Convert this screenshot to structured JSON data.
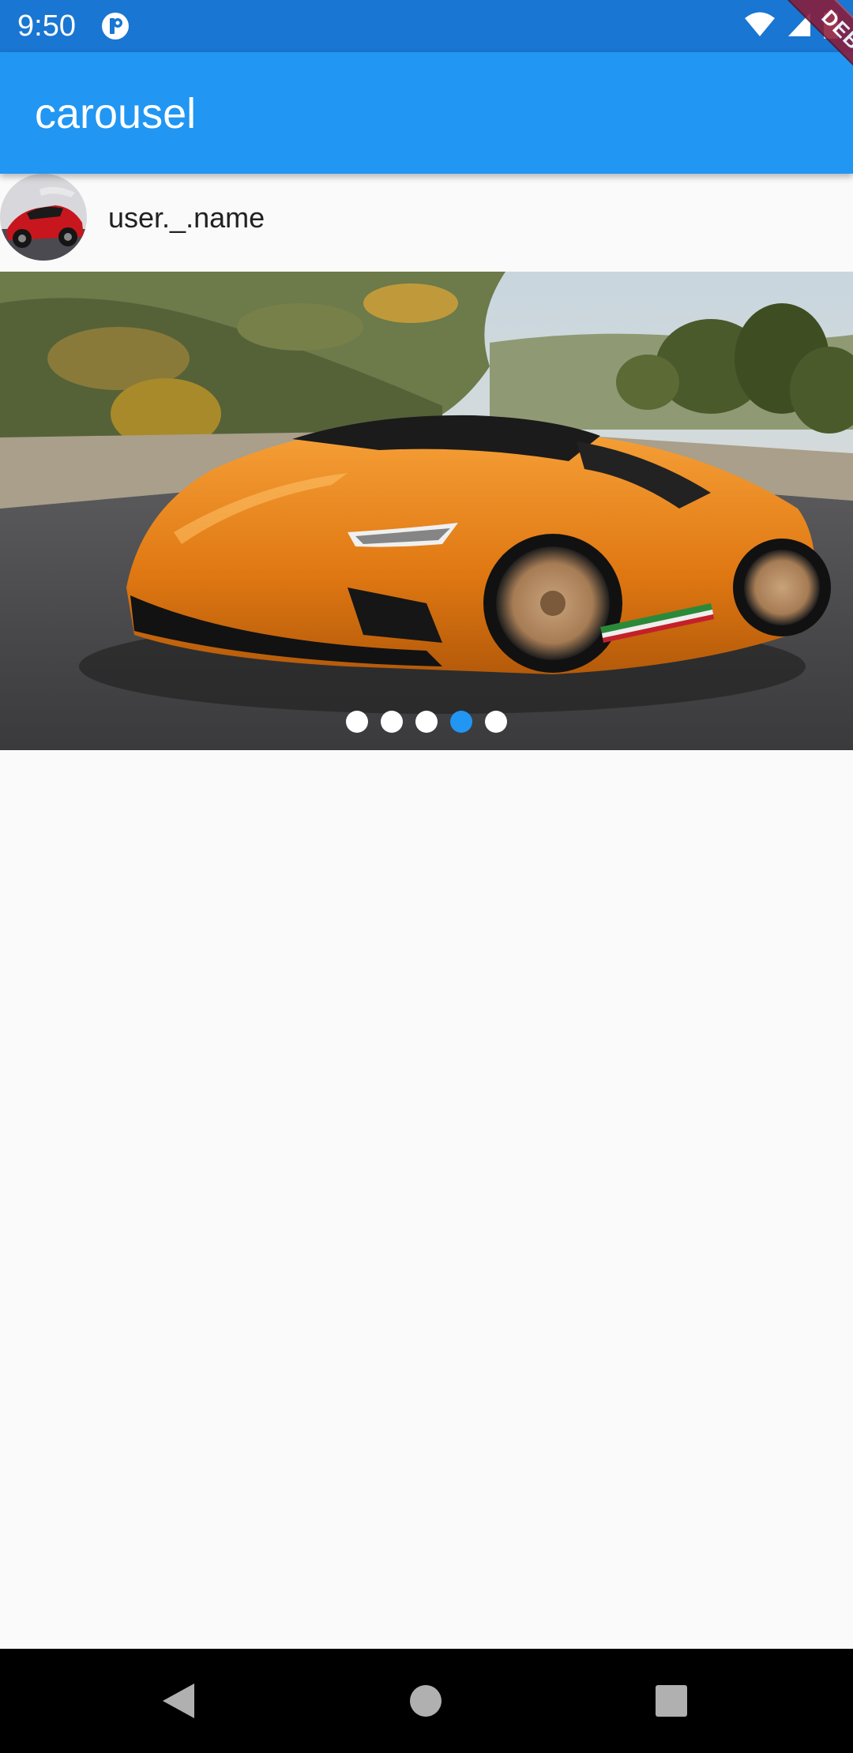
{
  "status_bar": {
    "time": "9:50",
    "app_icon": "pocket-icon",
    "icons": [
      "wifi-icon",
      "signal-icon",
      "battery-icon"
    ]
  },
  "debug_banner": {
    "label": "DEBUG"
  },
  "app_bar": {
    "title": "carousel"
  },
  "user": {
    "name": "user._.name",
    "avatar_icon": "red-car-avatar"
  },
  "carousel": {
    "page_count": 5,
    "active_index": 3,
    "image": "orange-sports-car-image"
  },
  "nav_bar": {
    "buttons": [
      "back",
      "home",
      "recents"
    ]
  },
  "colors": {
    "status_bar": "#1976d2",
    "app_bar": "#2196f3",
    "active_dot": "#2196f3",
    "inactive_dot": "#ffffff",
    "background": "#fafafa",
    "debug_ribbon": "#8b1b3a"
  }
}
